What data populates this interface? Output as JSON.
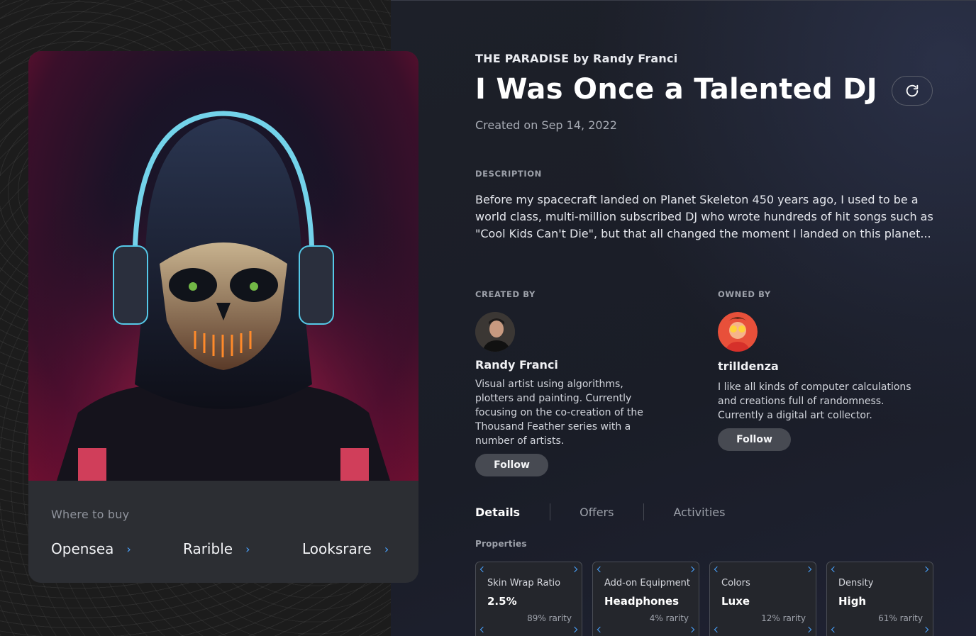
{
  "nft": {
    "collection": "THE PARADISE by Randy Franci",
    "title": "I Was Once a Talented DJ",
    "created_on": "Created on Sep 14, 2022",
    "description_label": "DESCRIPTION",
    "description": "Before my spacecraft landed on Planet Skeleton 450 years ago, I used to be a world class, multi-million subscribed DJ who wrote hundreds of hit songs such as \"Cool Kids Can't Die\", but that all changed the moment I landed on this planet..."
  },
  "buy": {
    "title": "Where to buy",
    "markets": [
      {
        "label": "Opensea",
        "icon": "chevron-right-icon"
      },
      {
        "label": "Rarible",
        "icon": "chevron-right-icon"
      },
      {
        "label": "Looksrare",
        "icon": "chevron-right-icon"
      }
    ]
  },
  "creator": {
    "label": "CREATED BY",
    "name": "Randy Franci",
    "bio": "Visual artist using algorithms, plotters and painting. Currently focusing on the co-creation of the Thousand Feather series with a number of artists.",
    "follow_label": "Follow"
  },
  "owner": {
    "label": "OWNED BY",
    "name": "trilldenza",
    "bio": "I like all kinds of computer calculations and creations full of randomness. Currently a digital art collector.",
    "follow_label": "Follow"
  },
  "tabs": [
    "Details",
    "Offers",
    "Activities"
  ],
  "properties_label": "Properties",
  "properties": [
    {
      "type": "Skin Wrap Ratio",
      "value": "2.5%",
      "rarity": "89% rarity"
    },
    {
      "type": "Add-on Equipment",
      "value": "Headphones",
      "rarity": "4% rarity"
    },
    {
      "type": "Colors",
      "value": "Luxe",
      "rarity": "12% rarity"
    },
    {
      "type": "Density",
      "value": "High",
      "rarity": "61% rarity"
    }
  ],
  "colors": {
    "accent": "#4aa3ff",
    "button_bg": "#474a52",
    "panel_bg": "#2c2e33"
  },
  "icons": {
    "refresh": "refresh-icon"
  }
}
